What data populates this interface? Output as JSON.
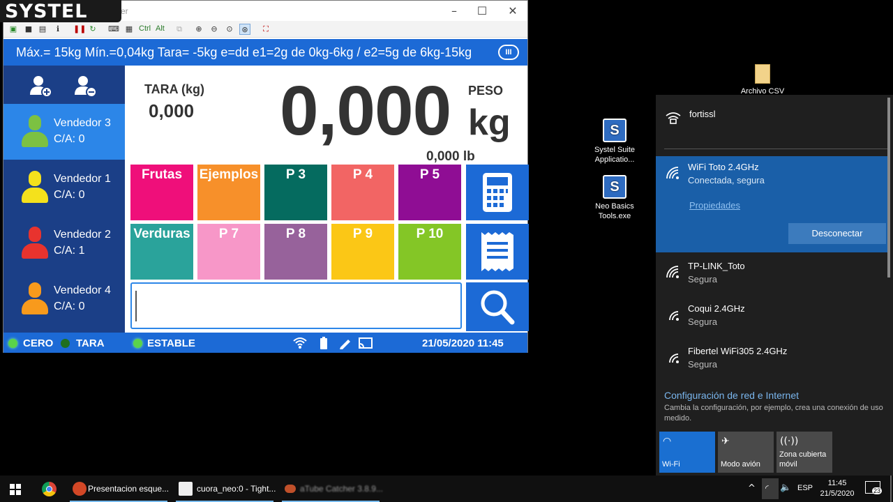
{
  "logo": {
    "text": "SYSTEL"
  },
  "vnc_window": {
    "title": "er",
    "toolbar_text": [
      "Ctrl",
      "Alt"
    ]
  },
  "scale": {
    "spec": "Máx.= 15kg  Mín.=0,04kg  Tara= -5kg  e=dd  e1=2g de 0kg-6kg / e2=5g de 6kg-15kg",
    "spec_badge": "III",
    "vendors": [
      {
        "name": "Vendedor 3",
        "ca": "C/A: 0",
        "color": "#7cc142",
        "active": true
      },
      {
        "name": "Vendedor 1",
        "ca": "C/A: 0",
        "color": "#f4e11c",
        "active": false
      },
      {
        "name": "Vendedor 2",
        "ca": "C/A: 1",
        "color": "#e8332e",
        "active": false
      },
      {
        "name": "Vendedor 4",
        "ca": "C/A: 0",
        "color": "#f89a1c",
        "active": false
      }
    ],
    "tara_label": "TARA (kg)",
    "tara_value": "0,000",
    "peso_label": "PESO",
    "peso_value": "0,000",
    "peso_unit": "kg",
    "lb_value": "0,000  lb",
    "tiles": [
      {
        "label": "Frutas",
        "color": "#ef0f7a"
      },
      {
        "label": "Ejemplos",
        "color": "#f7902a"
      },
      {
        "label": "P 3",
        "color": "#056b5f"
      },
      {
        "label": "P 4",
        "color": "#f26564"
      },
      {
        "label": "P 5",
        "color": "#8f0d94"
      },
      {
        "label": "Verduras",
        "color": "#2aa39b"
      },
      {
        "label": "P 7",
        "color": "#f797c8"
      },
      {
        "label": "P 8",
        "color": "#97629b"
      },
      {
        "label": "P 9",
        "color": "#fbc716"
      },
      {
        "label": "P 10",
        "color": "#84c626"
      }
    ],
    "status": {
      "cero": "CERO",
      "tara": "TARA",
      "estable": "ESTABLE",
      "datetime": "21/05/2020   11:45"
    }
  },
  "desktop": {
    "icons": [
      {
        "label": "Archivo CSV"
      },
      {
        "label": "Systel Suite Applicatio..."
      },
      {
        "label": "Neo Basics Tools.exe"
      }
    ]
  },
  "network": {
    "top_network": "fortissl",
    "connected": {
      "name": "WiFi Toto 2.4GHz",
      "status": "Conectada, segura",
      "props": "Propiedades",
      "disconnect": "Desconectar"
    },
    "others": [
      {
        "name": "TP-LINK_Toto",
        "status": "Segura"
      },
      {
        "name": "Coqui 2.4GHz",
        "status": "Segura"
      },
      {
        "name": "Fibertel WiFi305 2.4GHz",
        "status": "Segura"
      }
    ],
    "settings_title": "Configuración de red e Internet",
    "settings_desc": "Cambia la configuración, por ejemplo, crea una conexión de uso medido.",
    "quick": [
      {
        "label": "Wi-Fi",
        "active": true
      },
      {
        "label": "Modo avión",
        "active": false
      },
      {
        "label": "Zona cubierta móvil",
        "active": false
      }
    ]
  },
  "taskbar": {
    "apps": [
      {
        "label": "Presentacion esque..."
      },
      {
        "label": "cuora_neo:0 - Tight..."
      },
      {
        "label": "aTube Catcher 3.8.9..."
      }
    ],
    "lang": "ESP",
    "time": "11:45",
    "date": "21/5/2020",
    "notif_count": "23"
  }
}
